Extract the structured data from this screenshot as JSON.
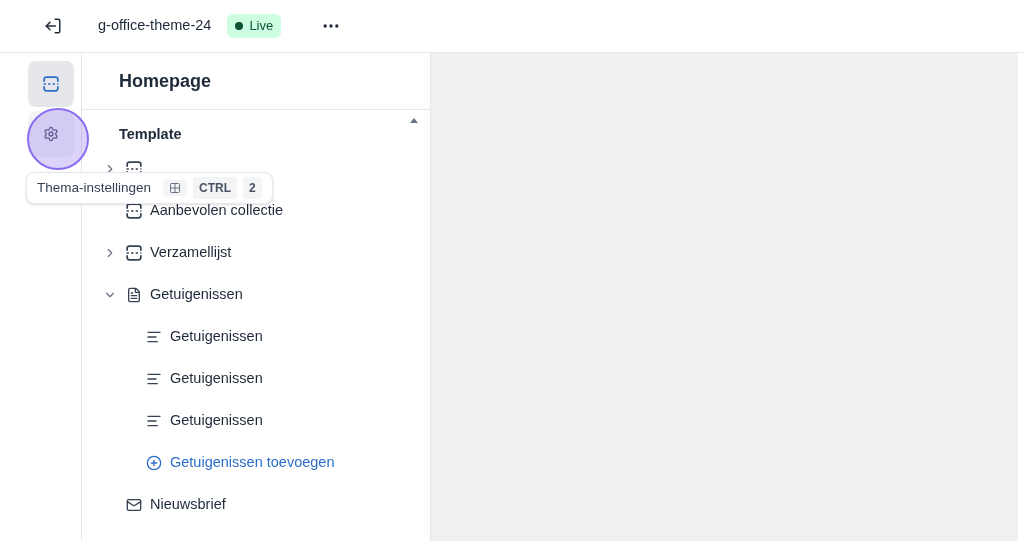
{
  "top_bar": {
    "theme_name": "g-office-theme-24",
    "status_badge": "Live"
  },
  "rail": [
    {
      "kind": "sections",
      "selected": true
    },
    {
      "kind": "settings",
      "selected": false
    }
  ],
  "tooltip": {
    "label": "Thema-instellingen",
    "keys": [
      "CTRL",
      "2"
    ]
  },
  "panel": {
    "title": "Homepage",
    "group": "Template",
    "sections": [
      {
        "kind": "slideshow",
        "expanded": false
      },
      {
        "kind": "collection",
        "label": "Aanbevolen collectie"
      },
      {
        "kind": "collection",
        "expanded": false,
        "label": "Verzamellijst"
      },
      {
        "kind": "testimonial",
        "expanded": true,
        "label": "Getuigenissen",
        "children": [
          {
            "kind": "block",
            "label": "Getuigenissen"
          },
          {
            "kind": "block",
            "label": "Getuigenissen"
          },
          {
            "kind": "block",
            "label": "Getuigenissen"
          },
          {
            "kind": "add",
            "label": "Getuigenissen toevoegen"
          }
        ]
      },
      {
        "kind": "newsletter",
        "label": "Nieuwsbrief"
      }
    ]
  }
}
